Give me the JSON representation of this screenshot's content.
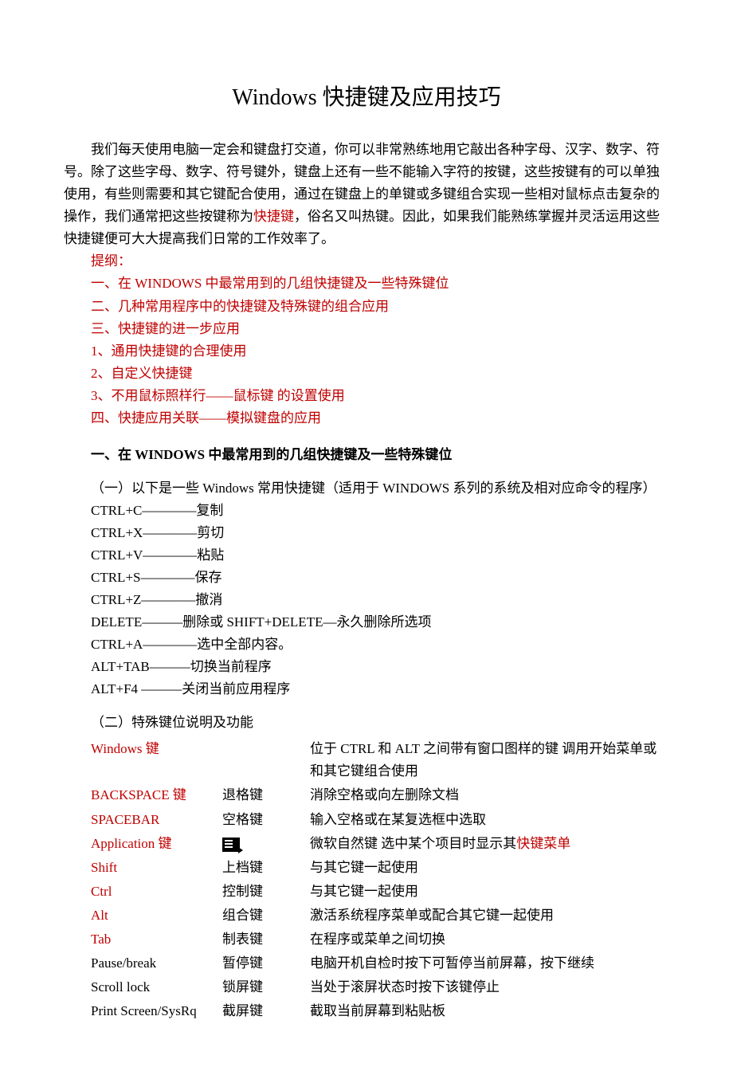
{
  "title": "Windows 快捷键及应用技巧",
  "intro": {
    "p1a": "我们每天使用电脑一定会和键盘打交道，你可以非常熟练地用它敲出各种字母、汉字、数字、符号。除了这些字母、数字、符号键外，键盘上还有一些不能输入字符的按键，这些按键有的可以单独使用，有些则需要和其它键配合使用，",
    "p1b": "通过在键盘上的单键或多键组合实现一些相对鼠标点击复杂的操作，",
    "p1c": "我们通常把这些按键称为",
    "kw": "快捷键",
    "p1d": "，俗名又叫热键。因此，如果我们能熟练掌握并灵活运用这些快捷键便可大大提高我们日常的工作效率了。"
  },
  "outline": {
    "h": "提纲：",
    "i1": "一、在 WINDOWS 中最常用到的几组快捷键及一些特殊键位",
    "i2": "二、几种常用程序中的快捷键及特殊键的组合应用",
    "i3": "三、快捷键的进一步应用",
    "i4": "1、通用快捷键的合理使用",
    "i5": "2、自定义快捷键",
    "i6": "3、不用鼠标照样行——鼠标键 的设置使用",
    "i7": "四、快捷应用关联——模拟键盘的应用"
  },
  "sec1": {
    "h": "一、在 WINDOWS 中最常用到的几组快捷键及一些特殊键位",
    "sub1": "（一）以下是一些 Windows 常用快捷键（适用于 WINDOWS 系列的系统及相对应命令的程序）",
    "s1": "CTRL+C————复制",
    "s2": "CTRL+X————剪切",
    "s3": "CTRL+V————粘贴",
    "s4": " CTRL+S————保存",
    "s5": " CTRL+Z————撤消",
    "s6": " DELETE———删除或 SHIFT+DELETE—永久删除所选项",
    "s7": " CTRL+A————选中全部内容。",
    "s8": "ALT+TAB———切换当前程序",
    "s9": " ALT+F4 ———关闭当前应用程序",
    "sub2": "（二）特殊键位说明及功能"
  },
  "tbl": [
    {
      "k": "Windows 键",
      "red": true,
      "n": "",
      "d": "位于 CTRL 和 ALT 之间带有窗口图样的键   调用开始菜单或和其它键组合使用"
    },
    {
      "k": "BACKSPACE 键",
      "red": true,
      "n": "退格键",
      "d": "消除空格或向左删除文档"
    },
    {
      "k": "SPACEBAR",
      "red": true,
      "n": "空格键",
      "d": "输入空格或在某复选框中选取"
    },
    {
      "k": "Application 键",
      "red": true,
      "n": "",
      "d": "微软自然键 选中某个项目时显示其",
      "dkw": "快键菜单",
      "icon": true
    },
    {
      "k": "Shift",
      "red": true,
      "n": "上档键",
      "d": "与其它键一起使用"
    },
    {
      "k": "Ctrl",
      "red": true,
      "n": "控制键",
      "d": "与其它键一起使用"
    },
    {
      "k": "Alt",
      "red": true,
      "n": "组合键",
      "d": "激活系统程序菜单或配合其它键一起使用"
    },
    {
      "k": "Tab",
      "red": true,
      "n": "制表键",
      "d": "在程序或菜单之间切换"
    },
    {
      "k": "Pause/break",
      "red": false,
      "n": "暂停键",
      "d": "电脑开机自检时按下可暂停当前屏幕，按下继续"
    },
    {
      "k": "Scroll lock",
      "red": false,
      "n": "锁屏键",
      "d": "当处于滚屏状态时按下该键停止"
    },
    {
      "k": "Print Screen/SysRq",
      "red": false,
      "n": "截屏键",
      "d": "截取当前屏幕到粘贴板"
    }
  ]
}
